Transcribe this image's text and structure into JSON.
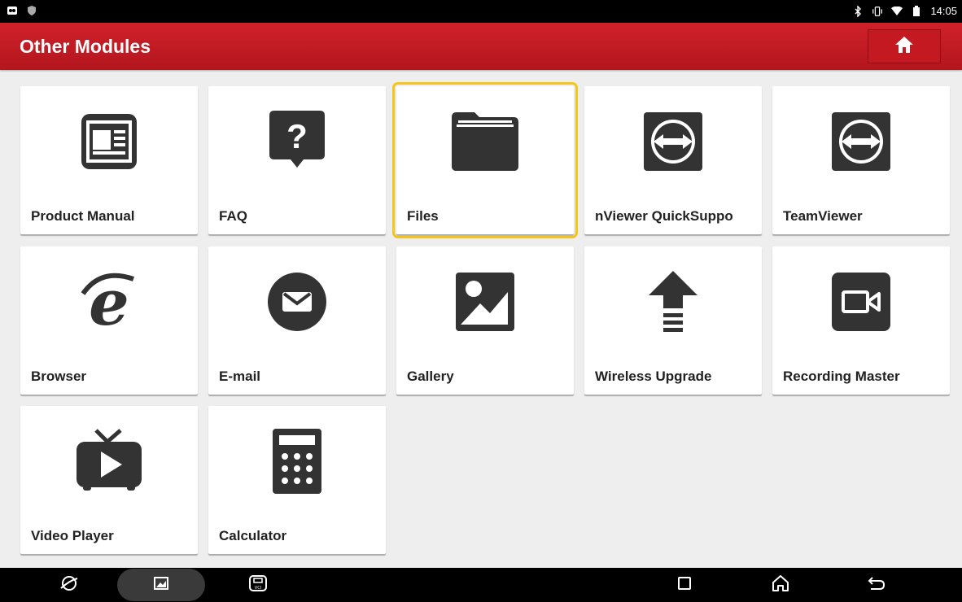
{
  "status_bar": {
    "time": "14:05"
  },
  "header": {
    "title": "Other Modules",
    "home_icon": "home-icon"
  },
  "tiles": [
    {
      "label": "Product Manual",
      "icon": "document-icon"
    },
    {
      "label": "FAQ",
      "icon": "question-icon"
    },
    {
      "label": "Files",
      "icon": "folder-icon",
      "selected": true
    },
    {
      "label": "nViewer QuickSuppo",
      "icon": "teamviewer-icon"
    },
    {
      "label": "TeamViewer",
      "icon": "teamviewer-icon"
    },
    {
      "label": "Browser",
      "icon": "browser-icon"
    },
    {
      "label": "E-mail",
      "icon": "email-icon"
    },
    {
      "label": "Gallery",
      "icon": "gallery-icon"
    },
    {
      "label": "Wireless Upgrade",
      "icon": "upgrade-icon"
    },
    {
      "label": "Recording Master",
      "icon": "video-camera-icon"
    },
    {
      "label": "Video Player",
      "icon": "tv-play-icon"
    },
    {
      "label": "Calculator",
      "icon": "calculator-icon"
    }
  ],
  "colors": {
    "header": "#c41920",
    "selected_outline": "#f5c518",
    "icon": "#333333"
  }
}
